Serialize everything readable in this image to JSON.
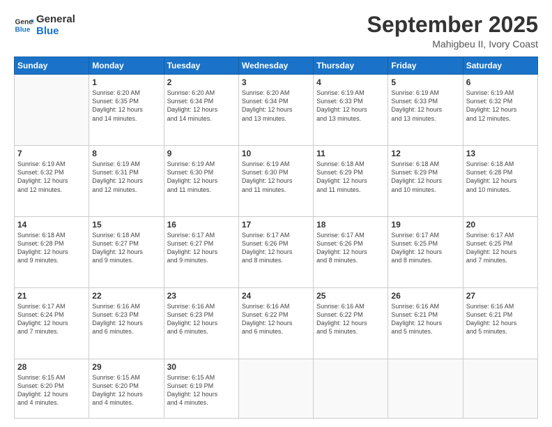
{
  "logo": {
    "line1": "General",
    "line2": "Blue"
  },
  "title": "September 2025",
  "location": "Mahigbeu II, Ivory Coast",
  "days_header": [
    "Sunday",
    "Monday",
    "Tuesday",
    "Wednesday",
    "Thursday",
    "Friday",
    "Saturday"
  ],
  "weeks": [
    [
      {
        "day": "",
        "info": ""
      },
      {
        "day": "1",
        "info": "Sunrise: 6:20 AM\nSunset: 6:35 PM\nDaylight: 12 hours\nand 14 minutes."
      },
      {
        "day": "2",
        "info": "Sunrise: 6:20 AM\nSunset: 6:34 PM\nDaylight: 12 hours\nand 14 minutes."
      },
      {
        "day": "3",
        "info": "Sunrise: 6:20 AM\nSunset: 6:34 PM\nDaylight: 12 hours\nand 13 minutes."
      },
      {
        "day": "4",
        "info": "Sunrise: 6:19 AM\nSunset: 6:33 PM\nDaylight: 12 hours\nand 13 minutes."
      },
      {
        "day": "5",
        "info": "Sunrise: 6:19 AM\nSunset: 6:33 PM\nDaylight: 12 hours\nand 13 minutes."
      },
      {
        "day": "6",
        "info": "Sunrise: 6:19 AM\nSunset: 6:32 PM\nDaylight: 12 hours\nand 12 minutes."
      }
    ],
    [
      {
        "day": "7",
        "info": "Sunrise: 6:19 AM\nSunset: 6:32 PM\nDaylight: 12 hours\nand 12 minutes."
      },
      {
        "day": "8",
        "info": "Sunrise: 6:19 AM\nSunset: 6:31 PM\nDaylight: 12 hours\nand 12 minutes."
      },
      {
        "day": "9",
        "info": "Sunrise: 6:19 AM\nSunset: 6:30 PM\nDaylight: 12 hours\nand 11 minutes."
      },
      {
        "day": "10",
        "info": "Sunrise: 6:19 AM\nSunset: 6:30 PM\nDaylight: 12 hours\nand 11 minutes."
      },
      {
        "day": "11",
        "info": "Sunrise: 6:18 AM\nSunset: 6:29 PM\nDaylight: 12 hours\nand 11 minutes."
      },
      {
        "day": "12",
        "info": "Sunrise: 6:18 AM\nSunset: 6:29 PM\nDaylight: 12 hours\nand 10 minutes."
      },
      {
        "day": "13",
        "info": "Sunrise: 6:18 AM\nSunset: 6:28 PM\nDaylight: 12 hours\nand 10 minutes."
      }
    ],
    [
      {
        "day": "14",
        "info": "Sunrise: 6:18 AM\nSunset: 6:28 PM\nDaylight: 12 hours\nand 9 minutes."
      },
      {
        "day": "15",
        "info": "Sunrise: 6:18 AM\nSunset: 6:27 PM\nDaylight: 12 hours\nand 9 minutes."
      },
      {
        "day": "16",
        "info": "Sunrise: 6:17 AM\nSunset: 6:27 PM\nDaylight: 12 hours\nand 9 minutes."
      },
      {
        "day": "17",
        "info": "Sunrise: 6:17 AM\nSunset: 6:26 PM\nDaylight: 12 hours\nand 8 minutes."
      },
      {
        "day": "18",
        "info": "Sunrise: 6:17 AM\nSunset: 6:26 PM\nDaylight: 12 hours\nand 8 minutes."
      },
      {
        "day": "19",
        "info": "Sunrise: 6:17 AM\nSunset: 6:25 PM\nDaylight: 12 hours\nand 8 minutes."
      },
      {
        "day": "20",
        "info": "Sunrise: 6:17 AM\nSunset: 6:25 PM\nDaylight: 12 hours\nand 7 minutes."
      }
    ],
    [
      {
        "day": "21",
        "info": "Sunrise: 6:17 AM\nSunset: 6:24 PM\nDaylight: 12 hours\nand 7 minutes."
      },
      {
        "day": "22",
        "info": "Sunrise: 6:16 AM\nSunset: 6:23 PM\nDaylight: 12 hours\nand 6 minutes."
      },
      {
        "day": "23",
        "info": "Sunrise: 6:16 AM\nSunset: 6:23 PM\nDaylight: 12 hours\nand 6 minutes."
      },
      {
        "day": "24",
        "info": "Sunrise: 6:16 AM\nSunset: 6:22 PM\nDaylight: 12 hours\nand 6 minutes."
      },
      {
        "day": "25",
        "info": "Sunrise: 6:16 AM\nSunset: 6:22 PM\nDaylight: 12 hours\nand 5 minutes."
      },
      {
        "day": "26",
        "info": "Sunrise: 6:16 AM\nSunset: 6:21 PM\nDaylight: 12 hours\nand 5 minutes."
      },
      {
        "day": "27",
        "info": "Sunrise: 6:16 AM\nSunset: 6:21 PM\nDaylight: 12 hours\nand 5 minutes."
      }
    ],
    [
      {
        "day": "28",
        "info": "Sunrise: 6:15 AM\nSunset: 6:20 PM\nDaylight: 12 hours\nand 4 minutes."
      },
      {
        "day": "29",
        "info": "Sunrise: 6:15 AM\nSunset: 6:20 PM\nDaylight: 12 hours\nand 4 minutes."
      },
      {
        "day": "30",
        "info": "Sunrise: 6:15 AM\nSunset: 6:19 PM\nDaylight: 12 hours\nand 4 minutes."
      },
      {
        "day": "",
        "info": ""
      },
      {
        "day": "",
        "info": ""
      },
      {
        "day": "",
        "info": ""
      },
      {
        "day": "",
        "info": ""
      }
    ]
  ]
}
